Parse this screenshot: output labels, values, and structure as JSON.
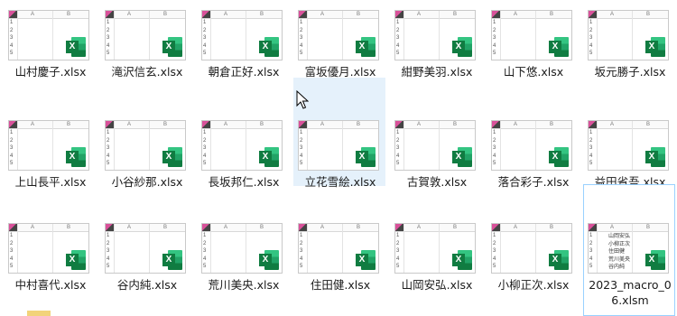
{
  "files": [
    {
      "name": "山村慶子.xlsx",
      "cells": []
    },
    {
      "name": "滝沢信玄.xlsx",
      "cells": []
    },
    {
      "name": "朝倉正好.xlsx",
      "cells": []
    },
    {
      "name": "富坂優月.xlsx",
      "cells": []
    },
    {
      "name": "紺野美羽.xlsx",
      "cells": []
    },
    {
      "name": "山下悠.xlsx",
      "cells": []
    },
    {
      "name": "坂元勝子.xlsx",
      "cells": []
    },
    {
      "name": "上山長平.xlsx",
      "cells": []
    },
    {
      "name": "小谷紗那.xlsx",
      "cells": []
    },
    {
      "name": "長坂邦仁.xlsx",
      "cells": []
    },
    {
      "name": "立花雪絵.xlsx",
      "cells": []
    },
    {
      "name": "古賀敦.xlsx",
      "cells": []
    },
    {
      "name": "落合彩子.xlsx",
      "cells": []
    },
    {
      "name": "益田省吾.xlsx",
      "cells": []
    },
    {
      "name": "中村喜代.xlsx",
      "cells": []
    },
    {
      "name": "谷内純.xlsx",
      "cells": []
    },
    {
      "name": "荒川美央.xlsx",
      "cells": []
    },
    {
      "name": "住田健.xlsx",
      "cells": []
    },
    {
      "name": "山岡安弘.xlsx",
      "cells": []
    },
    {
      "name": "小柳正次.xlsx",
      "cells": []
    },
    {
      "name": "2023_macro_06.xlsm",
      "cells": [
        "山岡安弘",
        "小柳正次",
        "住田健",
        "荒川美央",
        "谷内純"
      ]
    }
  ],
  "thumbnail": {
    "col_a": "A",
    "col_b": "B",
    "row_numbers": [
      "1",
      "2",
      "3",
      "4",
      "5"
    ],
    "app_letter": "X"
  },
  "state": {
    "hovered_index": 10,
    "selected_index": 20
  },
  "colors": {
    "hover_bg": "#e5f1fb",
    "selected_border": "#99d1ff",
    "excel_green": "#107c41"
  }
}
